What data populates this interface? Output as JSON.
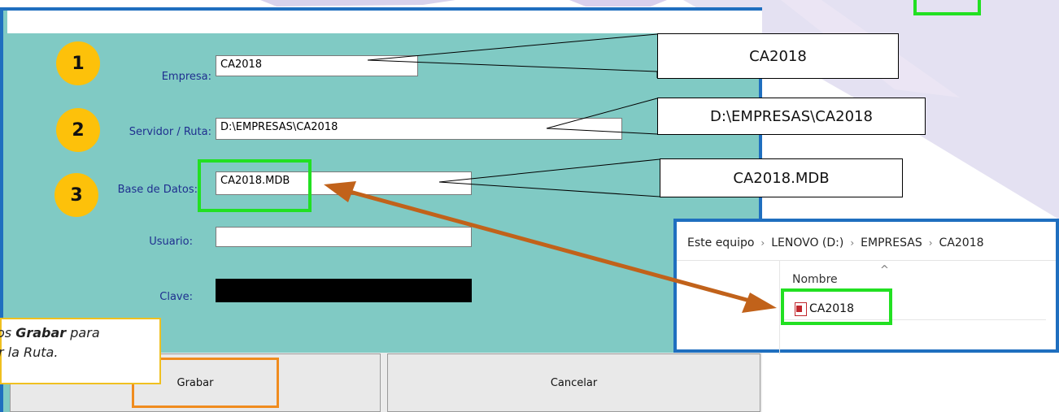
{
  "form": {
    "fields": [
      {
        "badge": "1",
        "label": "Empresa:",
        "value": "CA2018"
      },
      {
        "badge": "2",
        "label": "Servidor / Ruta:",
        "value": "D:\\EMPRESAS\\CA2018"
      },
      {
        "badge": "3",
        "label": "Base de Datos:",
        "value": "CA2018.MDB"
      },
      {
        "badge": "",
        "label": "Usuario:",
        "value": ""
      },
      {
        "badge": "",
        "label": "Clave:",
        "value": ""
      }
    ],
    "buttons": {
      "save": "Grabar",
      "cancel": "Cancelar"
    }
  },
  "callouts": {
    "company": "CA2018",
    "path": "D:\\EMPRESAS\\CA2018",
    "database": "CA2018.MDB"
  },
  "tip": {
    "line1_prefix": "os ",
    "line1_bold": "Grabar",
    "line1_suffix": " para",
    "line2": "r la Ruta."
  },
  "explorer": {
    "breadcrumb": [
      "Este equipo",
      "LENOVO (D:)",
      "EMPRESAS",
      "CA2018"
    ],
    "separator": "›",
    "column_header": "Nombre",
    "sort_glyph": "^",
    "file": {
      "name": "CA2018",
      "icon": "access-database-icon"
    }
  },
  "colors": {
    "dialog_bg": "#80cac4",
    "frame_blue": "#1f6fbf",
    "highlight_green": "#22e022",
    "badge_yellow": "#fdc10a",
    "arrow_orange": "#c1621a",
    "label_blue": "#1f2f8f",
    "tip_border": "#f0c020",
    "save_highlight": "#f08c1e"
  }
}
